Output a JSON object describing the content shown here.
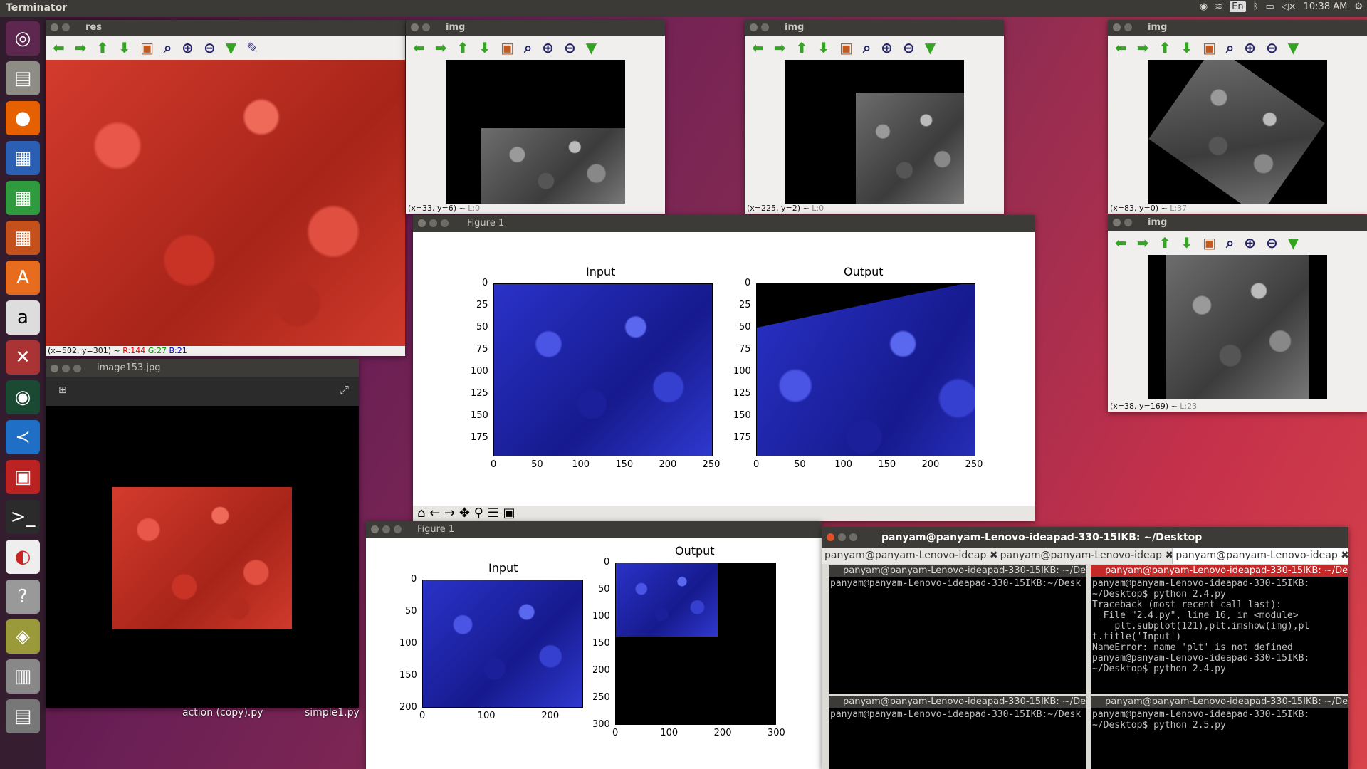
{
  "topbar": {
    "app": "Terminator",
    "lang": "En",
    "time": "10:38 AM"
  },
  "launcher": {
    "items": [
      "ubuntu-logo-icon",
      "files-icon",
      "firefox-icon",
      "writer-icon",
      "calc-icon",
      "impress-icon",
      "software-center-icon",
      "amazon-icon",
      "settings-icon",
      "webcam-icon",
      "vscode-icon",
      "terminator-icon",
      "terminal-icon",
      "ubuntu-one-icon",
      "help-icon",
      "system-monitor-icon",
      "workspaces-icon"
    ]
  },
  "res": {
    "title": "res",
    "status_xy": "(x=502, y=301) ~ ",
    "r": "R:144",
    "g": "G:27",
    "b": "B:21"
  },
  "img1": {
    "title": "img",
    "status_xy": "(x=33, y=6) ~ ",
    "l": "L:0"
  },
  "img2": {
    "title": "img",
    "status_xy": "(x=225, y=2) ~ ",
    "l": "L:0"
  },
  "img3": {
    "title": "img",
    "status_xy": "(x=83, y=0) ~ ",
    "l": "L:37"
  },
  "img4": {
    "title": "img",
    "status_xy": "(x=38, y=169) ~ ",
    "l": "L:23"
  },
  "viewer": {
    "title": "image153.jpg"
  },
  "figure1": {
    "title": "Figure 1",
    "in_title": "Input",
    "out_title": "Output",
    "yt": [
      "0",
      "25",
      "50",
      "75",
      "100",
      "125",
      "150",
      "175"
    ],
    "xt": [
      "0",
      "50",
      "100",
      "150",
      "200",
      "250"
    ]
  },
  "figure2": {
    "title": "Figure 1",
    "in_title": "Input",
    "out_title": "Output",
    "in_yt": [
      "0",
      "50",
      "100",
      "150",
      "200"
    ],
    "in_xt": [
      "0",
      "100",
      "200"
    ],
    "out_yt": [
      "0",
      "50",
      "100",
      "150",
      "200",
      "250",
      "300"
    ],
    "out_xt": [
      "0",
      "100",
      "200",
      "300"
    ]
  },
  "terminal": {
    "title": "panyam@panyam-Lenovo-ideapad-330-15IKB: ~/Desktop",
    "tabs": [
      "panyam@panyam-Lenovo-ideap",
      "panyam@panyam-Lenovo-ideap",
      "panyam@panyam-Lenovo-ideap"
    ],
    "p1_title": "panyam@panyam-Lenovo-ideapad-330-15IKB: ~/De",
    "p1_text": "panyam@panyam-Lenovo-ideapad-330-15IKB:~/Desk",
    "p2_title": "panyam@panyam-Lenovo-ideapad-330-15IKB: ~/De",
    "p2_text": "panyam@panyam-Lenovo-ideapad-330-15IKB:\n~/Desktop$ python 2.4.py\nTraceback (most recent call last):\n  File \"2.4.py\", line 16, in <module>\n    plt.subplot(121),plt.imshow(img),pl\nt.title('Input')\nNameError: name 'plt' is not defined\npanyam@panyam-Lenovo-ideapad-330-15IKB:\n~/Desktop$ python 2.4.py",
    "p3_title": "panyam@panyam-Lenovo-ideapad-330-15IKB: ~/De",
    "p3_text": "panyam@panyam-Lenovo-ideapad-330-15IKB:~/Desk",
    "p4_title": "panyam@panyam-Lenovo-ideapad-330-15IKB: ~/De",
    "p4_text": "panyam@panyam-Lenovo-ideapad-330-15IKB:\n~/Desktop$ python 2.5.py"
  },
  "desktop": {
    "file1": "action (copy).py",
    "file2": "simple1.py"
  }
}
